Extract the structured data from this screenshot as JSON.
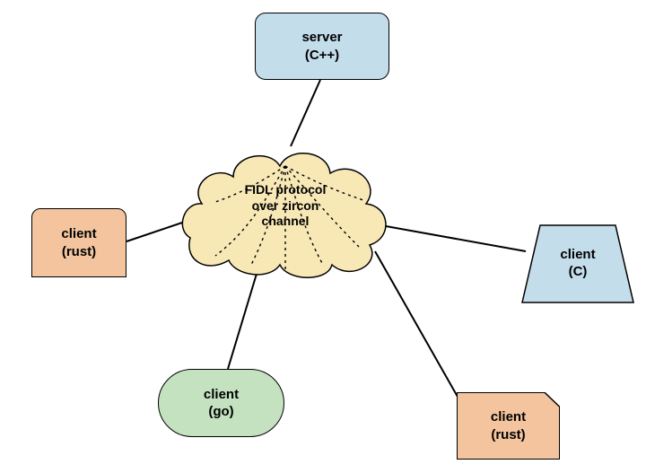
{
  "server": {
    "name": "server",
    "lang": "(C++)",
    "shape": "rounded-rect",
    "fill": "#C4DDEB"
  },
  "protocol_cloud": {
    "line1": "FIDL protocol",
    "line2": "over zircon",
    "line3": "channel",
    "fill": "#F7E8B6"
  },
  "clients": {
    "rust_left": {
      "name": "client",
      "lang": "(rust)",
      "shape": "rounded-top-rect",
      "fill": "#F3C49E"
    },
    "c_right": {
      "name": "client",
      "lang": "(C)",
      "shape": "trapezoid",
      "fill": "#C4DDEB"
    },
    "go_bottom": {
      "name": "client",
      "lang": "(go)",
      "shape": "pill",
      "fill": "#C4E2C0"
    },
    "rust_br": {
      "name": "client",
      "lang": "(rust)",
      "shape": "cut-corner-rect",
      "fill": "#F3C49E"
    }
  },
  "edges": [
    {
      "from": "server",
      "to": "protocol_cloud"
    },
    {
      "from": "clients.rust_left",
      "to": "protocol_cloud"
    },
    {
      "from": "clients.c_right",
      "to": "protocol_cloud"
    },
    {
      "from": "clients.go_bottom",
      "to": "protocol_cloud"
    },
    {
      "from": "clients.rust_br",
      "to": "protocol_cloud"
    }
  ]
}
